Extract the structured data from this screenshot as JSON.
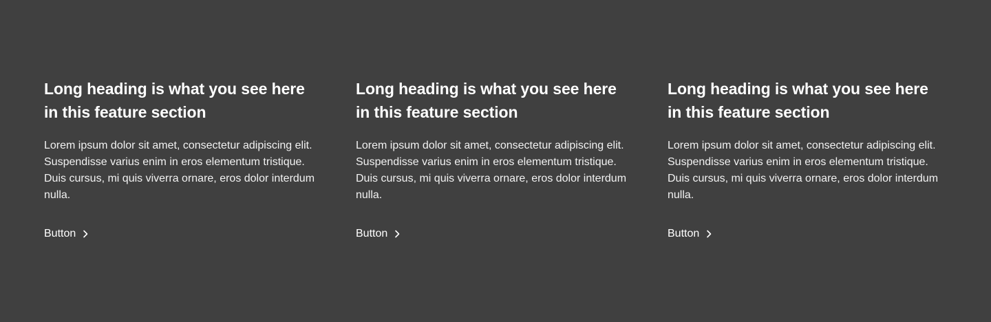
{
  "features": [
    {
      "heading": "Long heading is what you see here in this feature section",
      "body": "Lorem ipsum dolor sit amet, consectetur adipiscing elit. Suspendisse varius enim in eros elementum tristique. Duis cursus, mi quis viverra ornare, eros dolor interdum nulla.",
      "button_label": "Button",
      "button_icon": "chevron-right-icon"
    },
    {
      "heading": "Long heading is what you see here in this feature section",
      "body": "Lorem ipsum dolor sit amet, consectetur adipiscing elit. Suspendisse varius enim in eros elementum tristique. Duis cursus, mi quis viverra ornare, eros dolor interdum nulla.",
      "button_label": "Button",
      "button_icon": "chevron-right-icon"
    },
    {
      "heading": "Long heading is what you see here in this feature section",
      "body": "Lorem ipsum dolor sit amet, consectetur adipiscing elit. Suspendisse varius enim in eros elementum tristique. Duis cursus, mi quis viverra ornare, eros dolor interdum nulla.",
      "button_label": "Button",
      "button_icon": "chevron-right-icon"
    }
  ],
  "colors": {
    "background": "#404040",
    "text": "#ffffff"
  }
}
